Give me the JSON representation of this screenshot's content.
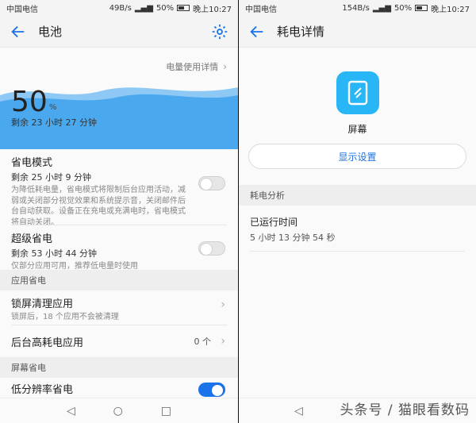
{
  "left": {
    "status": {
      "carrier": "中国电信",
      "speed": "49B/s",
      "battery": "50%",
      "time": "晚上10:27"
    },
    "appbar": {
      "title": "电池"
    },
    "usage_link": "电量使用详情",
    "battery": {
      "percent": "50",
      "percent_sign": "%",
      "remaining": "剩余 23 小时 27 分钟",
      "level": 0.5
    },
    "power_saving": {
      "title": "省电模式",
      "remaining": "剩余 25 小时 9 分钟",
      "desc": "为降低耗电量，省电模式将限制后台应用活动，减弱或关闭部分视觉效果和系统提示音，关闭邮件后台自动获取。设备正在充电或充满电时，省电模式将自动关闭。",
      "enabled": false
    },
    "super_saving": {
      "title": "超级省电",
      "remaining": "剩余 53 小时 44 分钟",
      "desc": "仅部分应用可用，推荐低电量时使用",
      "enabled": false
    },
    "section_app": "应用省电",
    "lockscreen": {
      "title": "锁屏清理应用",
      "desc": "锁屏后，18 个应用不会被清理"
    },
    "background_high": {
      "title": "后台高耗电应用",
      "value": "0 个"
    },
    "section_screen": "屏幕省电",
    "low_res": {
      "title": "低分辨率省电",
      "enabled": true
    }
  },
  "right": {
    "status": {
      "carrier": "中国电信",
      "speed": "154B/s",
      "battery": "50%",
      "time": "晚上10:27"
    },
    "appbar": {
      "title": "耗电详情"
    },
    "app_name": "屏幕",
    "display_settings": "显示设置",
    "section_analysis": "耗电分析",
    "runtime": {
      "title": "已运行时间",
      "value": "5 小时 13 分钟 54 秒"
    }
  },
  "watermark": "头条号 / 猫眼看数码",
  "colors": {
    "accent": "#1a73e8",
    "wave": "#4aa8ef",
    "app_icon": "#29b6f6"
  }
}
